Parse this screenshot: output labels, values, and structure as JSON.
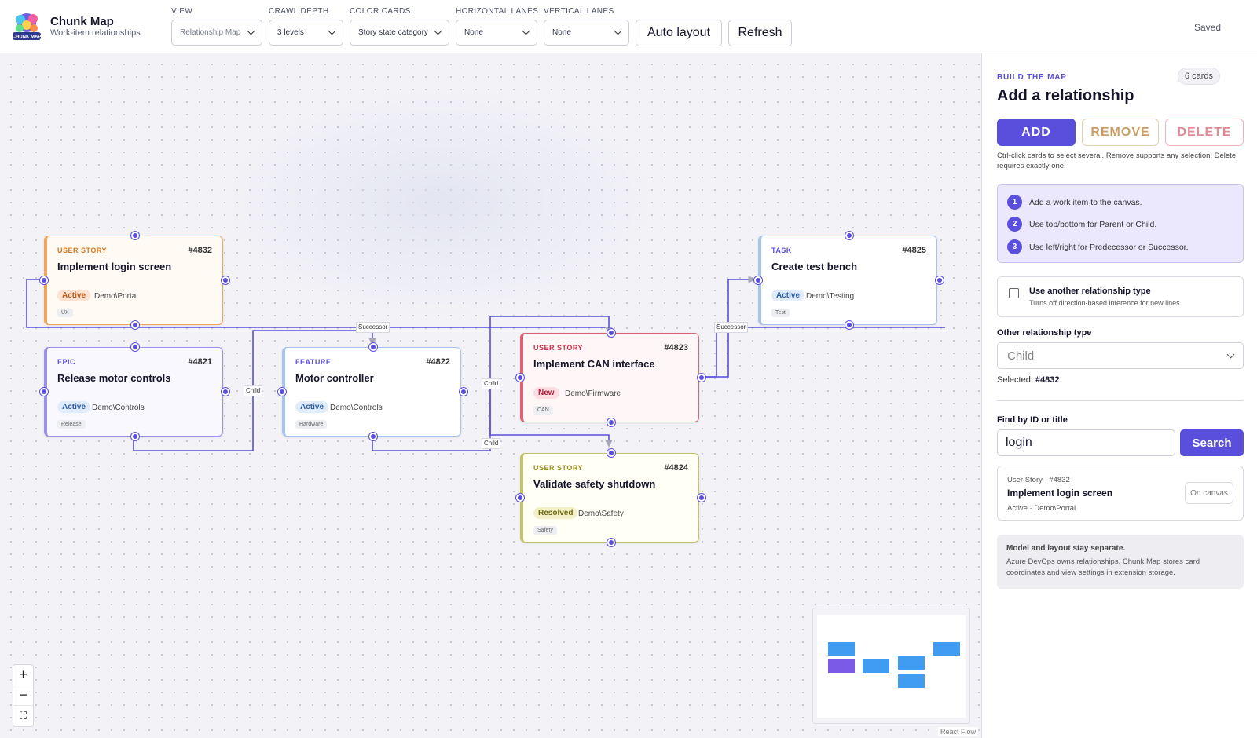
{
  "header": {
    "title": "Chunk Map",
    "subtitle": "Work-item relationships",
    "logo_text": "CHUNK MAP",
    "controls": [
      {
        "label": "VIEW",
        "value": "Relationship Map"
      },
      {
        "label": "CRAWL DEPTH",
        "value": "3 levels"
      },
      {
        "label": "COLOR CARDS",
        "value": "Story state category"
      },
      {
        "label": "HORIZONTAL LANES",
        "value": "None"
      },
      {
        "label": "VERTICAL LANES",
        "value": "None"
      }
    ],
    "auto_layout_label": "Auto layout",
    "refresh_label": "Refresh",
    "status": "Saved"
  },
  "cards": [
    {
      "type": "USER STORY",
      "id": "#4832",
      "title": "Implement login screen",
      "state": "Active",
      "area": "Demo\\Portal",
      "tag": "UX",
      "accent": "#f0a35a",
      "type_color": "#d9771d",
      "state_bg": "#fde3cf",
      "state_fg": "#c2591b",
      "tint": "#fffaf4"
    },
    {
      "type": "EPIC",
      "id": "#4821",
      "title": "Release motor controls",
      "state": "Active",
      "area": "Demo\\Controls",
      "tag": "Release",
      "accent": "#9b90ea",
      "type_color": "#5a4fdc",
      "state_bg": "#e1ecfb",
      "state_fg": "#2a5dab",
      "tint": "#f9f8ff"
    },
    {
      "type": "FEATURE",
      "id": "#4822",
      "title": "Motor controller",
      "state": "Active",
      "area": "Demo\\Controls",
      "tag": "Hardware",
      "accent": "#a9c4ec",
      "type_color": "#5a4fdc",
      "state_bg": "#e1ecfb",
      "state_fg": "#2a5dab",
      "tint": "#ffffff"
    },
    {
      "type": "USER STORY",
      "id": "#4823",
      "title": "Implement CAN interface",
      "state": "New",
      "area": "Demo\\Firmware",
      "tag": "CAN",
      "accent": "#e06173",
      "type_color": "#c8334a",
      "state_bg": "#fbdde2",
      "state_fg": "#b8213a",
      "tint": "#fff6f7"
    },
    {
      "type": "TASK",
      "id": "#4825",
      "title": "Create test bench",
      "state": "Active",
      "area": "Demo\\Testing",
      "tag": "Test",
      "accent": "#a9c4ec",
      "type_color": "#5a4fdc",
      "state_bg": "#e1ecfb",
      "state_fg": "#2a5dab",
      "tint": "#ffffff"
    },
    {
      "type": "USER STORY",
      "id": "#4824",
      "title": "Validate safety shutdown",
      "state": "Resolved",
      "area": "Demo\\Safety",
      "tag": "Safety",
      "accent": "#c5c36a",
      "type_color": "#9a8f18",
      "state_bg": "#f3efc7",
      "state_fg": "#6f6a10",
      "tint": "#fffff6"
    }
  ],
  "edge_labels": [
    "Successor",
    "Child",
    "Child",
    "Successor",
    "Child"
  ],
  "zoom": {
    "in": "+",
    "out": "−",
    "fit": "⛶"
  },
  "minimap_credit": "React Flow",
  "sidebar": {
    "eyebrow": "BUILD THE MAP",
    "card_count": "6 cards",
    "title": "Add a relationship",
    "modes": {
      "add": "ADD",
      "remove": "REMOVE",
      "delete": "DELETE"
    },
    "hint": "Ctrl-click cards to select several. Remove supports any selection; Delete requires exactly one.",
    "steps": [
      {
        "num": "1",
        "text": "Add a work item to the canvas."
      },
      {
        "num": "2",
        "text": "Use top/bottom for Parent or Child."
      },
      {
        "num": "3",
        "text": "Use left/right for Predecessor or Successor."
      }
    ],
    "other_type_toggle": {
      "title": "Use another relationship type",
      "subtitle": "Turns off direction-based inference for new lines.",
      "checked": false
    },
    "other_type_label": "Other relationship type",
    "other_type_value": "Child",
    "selected_label": "Selected:",
    "selected_value": "#4832",
    "find_label": "Find by ID or title",
    "search_value": "login",
    "search_button": "Search",
    "result": {
      "meta": "User Story · #4832",
      "title": "Implement login screen",
      "sub": "Active · Demo\\Portal",
      "badge": "On canvas"
    },
    "note": {
      "title": "Model and layout stay separate.",
      "body": "Azure DevOps owns relationships. Chunk Map stores card coordinates and view settings in extension storage."
    }
  },
  "colors": {
    "accent": "#5a4fdc",
    "edge": "#5a4fdc"
  }
}
